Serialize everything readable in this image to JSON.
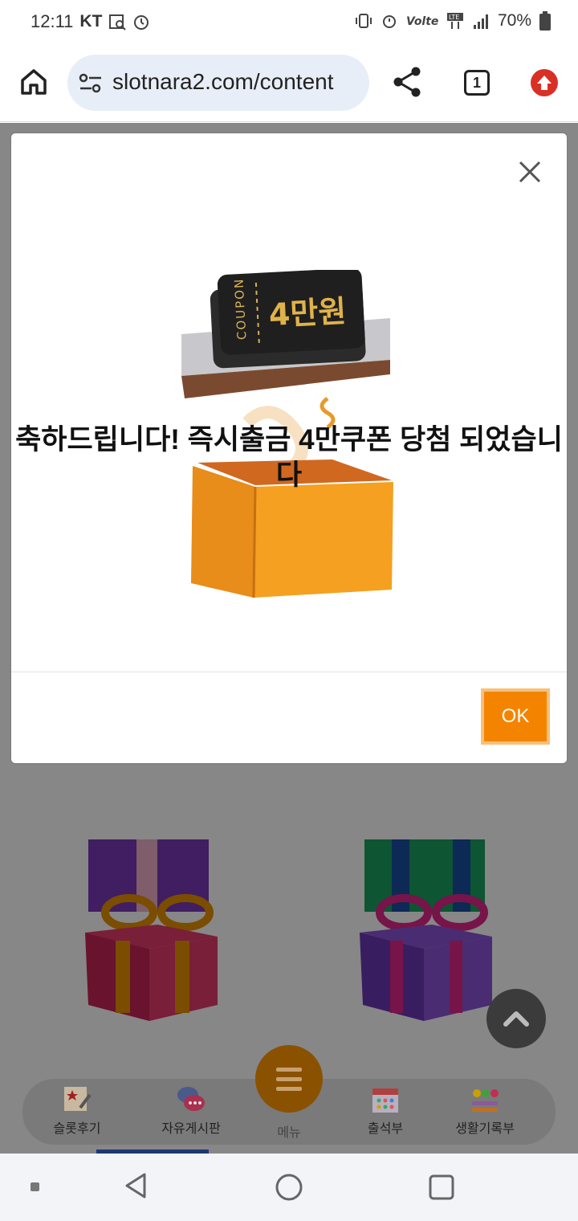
{
  "status_bar": {
    "time": "12:11",
    "carrier": "KT",
    "battery": "70%",
    "icons": [
      "gallery-search-icon",
      "alarm-icon",
      "vibrate-icon",
      "alarm-icon",
      "volte-icon",
      "lte-icon",
      "signal-icon",
      "battery-icon"
    ]
  },
  "browser": {
    "url": "slotnara2.com/content",
    "tab_count": "1"
  },
  "modal": {
    "message": "축하드립니다! 즉시출금 4만쿠폰 당첨 되었습니다",
    "coupon_label": "COUPON",
    "coupon_value": "4만원",
    "ok_label": "OK"
  },
  "bottom_nav": {
    "items": [
      {
        "label": "슬롯후기",
        "icon": "review-icon"
      },
      {
        "label": "자유게시판",
        "icon": "chat-icon"
      },
      {
        "label": "메뉴",
        "icon": "menu-icon"
      },
      {
        "label": "출석부",
        "icon": "calendar-icon"
      },
      {
        "label": "생활기록부",
        "icon": "emoji-icon"
      }
    ]
  },
  "colors": {
    "accent": "#f48400",
    "update": "#d93025",
    "url_bg": "#e8eef8"
  }
}
